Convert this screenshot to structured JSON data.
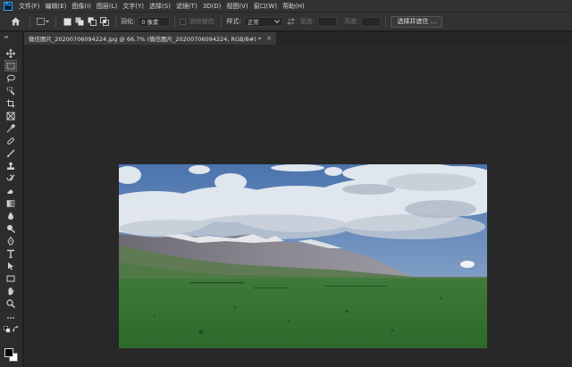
{
  "app": {
    "logo": "Ps"
  },
  "menu": [
    {
      "label": "文件(F)"
    },
    {
      "label": "编辑(E)"
    },
    {
      "label": "图像(I)"
    },
    {
      "label": "图层(L)"
    },
    {
      "label": "文字(Y)"
    },
    {
      "label": "选择(S)"
    },
    {
      "label": "滤镜(T)"
    },
    {
      "label": "3D(D)"
    },
    {
      "label": "视图(V)"
    },
    {
      "label": "窗口(W)"
    },
    {
      "label": "帮助(H)"
    }
  ],
  "options": {
    "home_icon": "home-icon",
    "feather_label": "羽化:",
    "feather_value": "0 像素",
    "antialias_label": "消除锯齿",
    "style_label": "样式:",
    "style_value": "正常",
    "width_label": "宽度:",
    "height_label": "高度:",
    "select_subject_label": "选择并遮住 ..."
  },
  "document": {
    "tab_title": "微信图片_20200706094224.jpg @ 66.7% (微信图片_20200706094224, RGB/8#) *",
    "close_glyph": "×"
  },
  "tools": [
    "move-tool",
    "marquee-tool",
    "lasso-tool",
    "quick-select-tool",
    "crop-tool",
    "frame-tool",
    "eyedropper-tool",
    "healing-brush-tool",
    "brush-tool",
    "clone-stamp-tool",
    "history-brush-tool",
    "eraser-tool",
    "gradient-tool",
    "blur-tool",
    "dodge-tool",
    "pen-tool",
    "type-tool",
    "path-select-tool",
    "rectangle-tool",
    "hand-tool",
    "zoom-tool",
    "more-tools",
    "default-colors",
    "swap-colors"
  ],
  "colors": {
    "foreground": "#000000",
    "background": "#ffffff",
    "accent": "#31a8ff"
  }
}
